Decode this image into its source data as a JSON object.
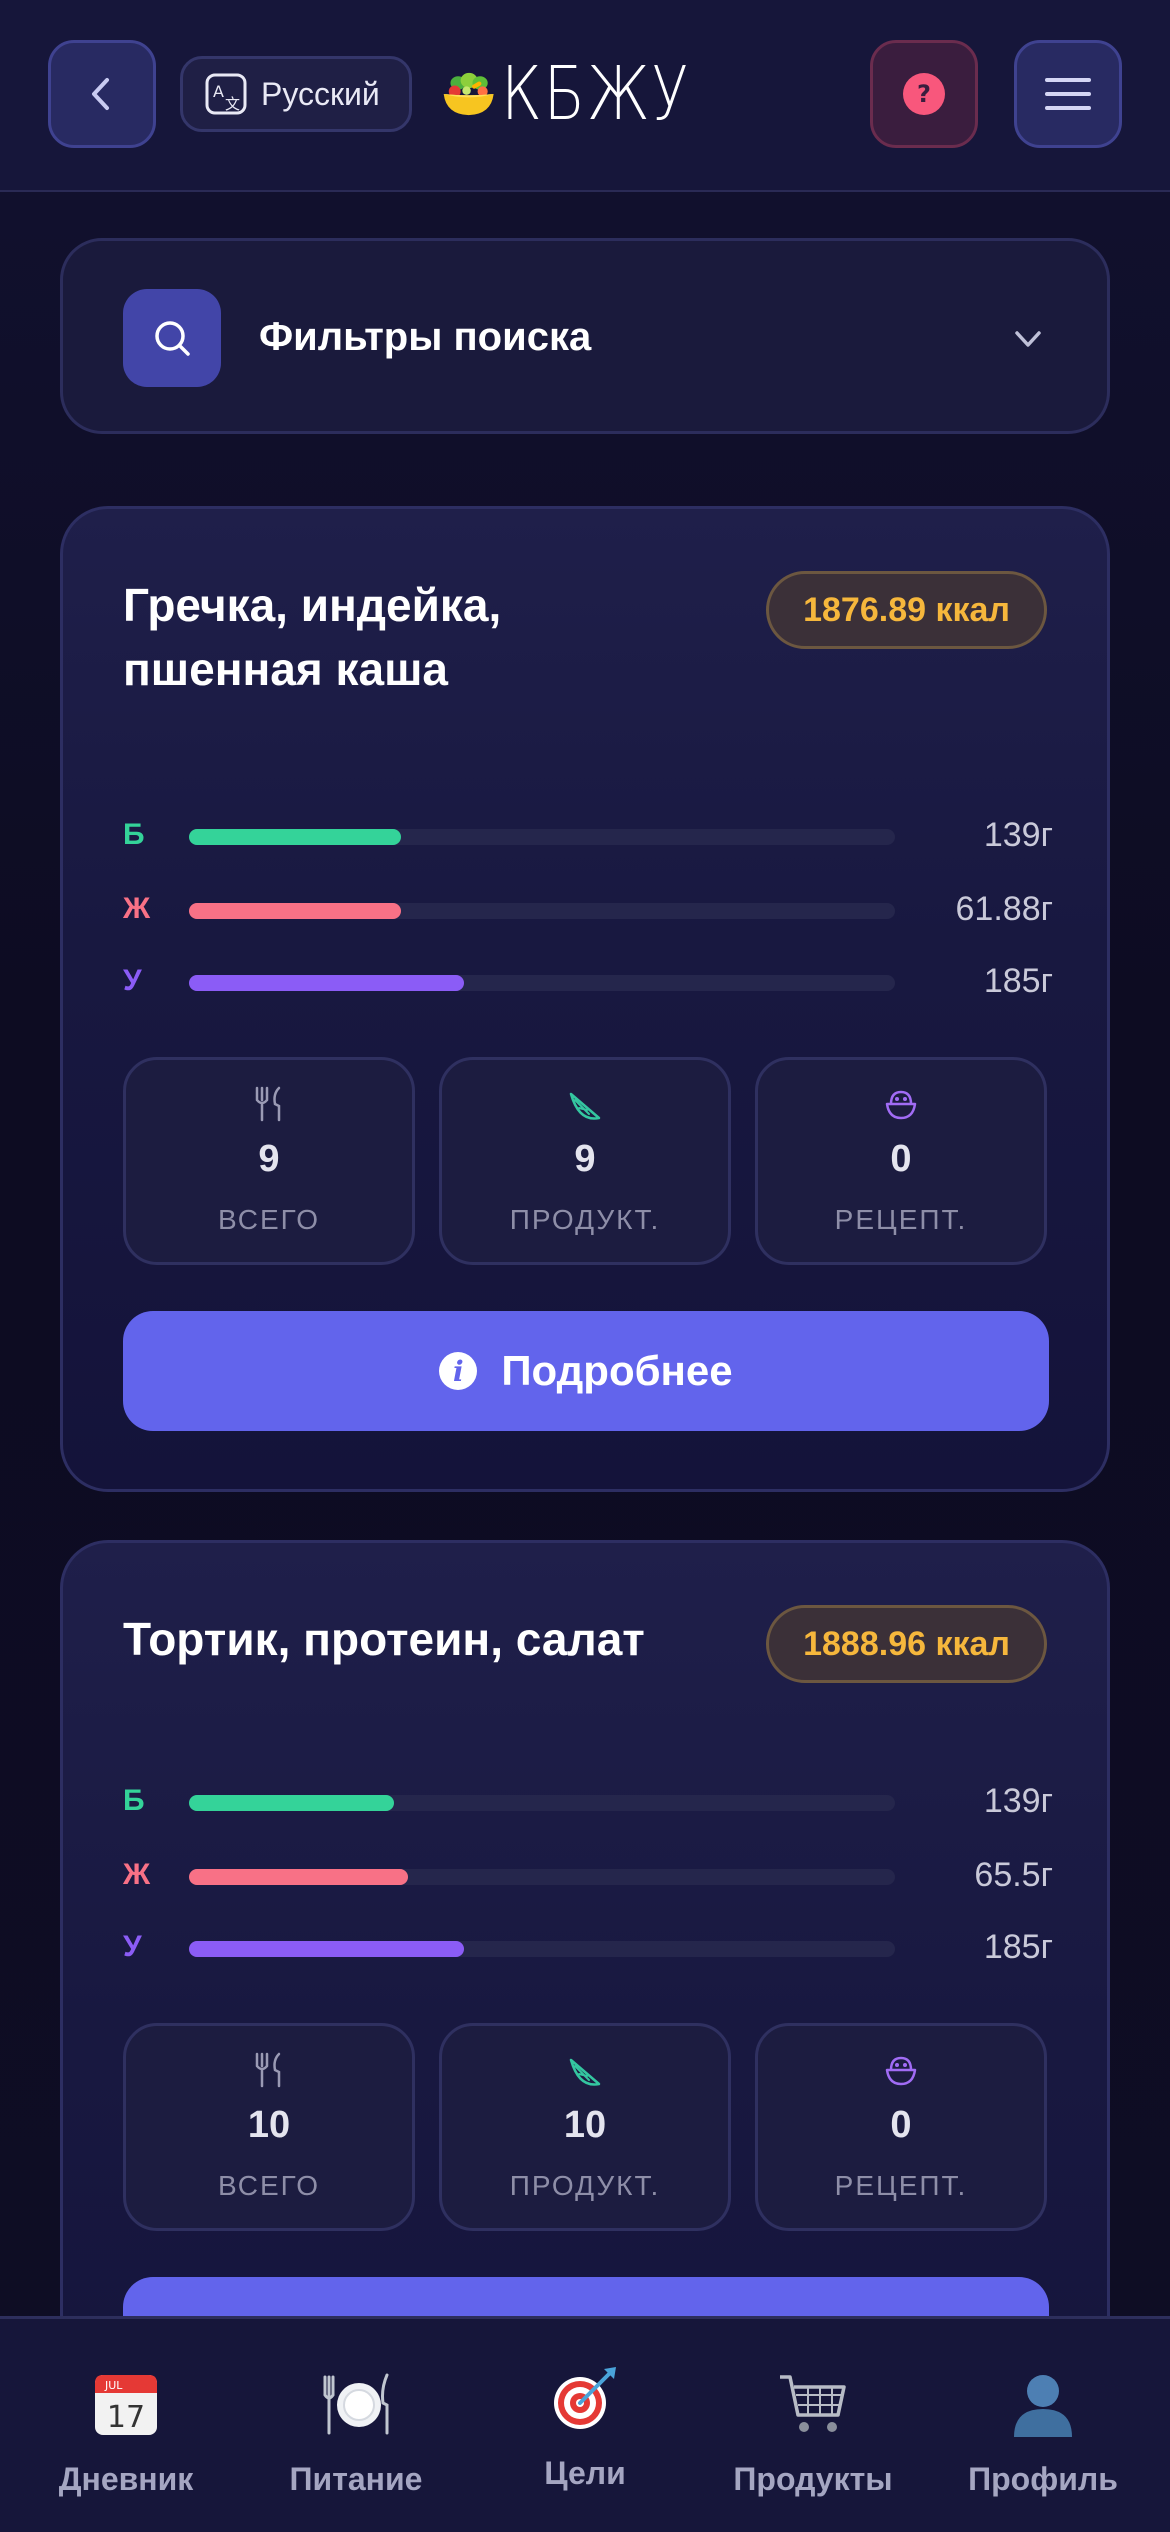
{
  "header": {
    "language": "Русский",
    "logo_text": "КБЖУ"
  },
  "filters": {
    "title": "Фильтры поиска"
  },
  "colors": {
    "protein": "#34d399",
    "fat": "#f87186",
    "carbs": "#8b5cf6",
    "accent": "#6264ec",
    "kcal": "#f6b73c"
  },
  "meals": [
    {
      "name": "Гречка, индейка, пшенная каша",
      "kcal": "1876.89 ккал",
      "macros": [
        {
          "letter": "Б",
          "amount": "139г",
          "level": 0.3
        },
        {
          "letter": "Ж",
          "amount": "61.88г",
          "level": 0.3
        },
        {
          "letter": "У",
          "amount": "185г",
          "level": 0.39
        }
      ],
      "stats": [
        {
          "icon": "cutlery-icon",
          "value": "9",
          "label": "ВСЕГО"
        },
        {
          "icon": "lemon-slice-icon",
          "value": "9",
          "label": "ПРОДУКТ."
        },
        {
          "icon": "bowl-icon",
          "value": "0",
          "label": "РЕЦЕПТ."
        }
      ],
      "button_label": "Подробнее"
    },
    {
      "name": "Тортик, протеин, салат",
      "kcal": "1888.96 ккал",
      "macros": [
        {
          "letter": "Б",
          "amount": "139г",
          "level": 0.29
        },
        {
          "letter": "Ж",
          "amount": "65.5г",
          "level": 0.31
        },
        {
          "letter": "У",
          "amount": "185г",
          "level": 0.39
        }
      ],
      "stats": [
        {
          "icon": "cutlery-icon",
          "value": "10",
          "label": "ВСЕГО"
        },
        {
          "icon": "lemon-slice-icon",
          "value": "10",
          "label": "ПРОДУКТ."
        },
        {
          "icon": "bowl-icon",
          "value": "0",
          "label": "РЕЦЕПТ."
        }
      ]
    }
  ],
  "nav": [
    {
      "label": "Дневник",
      "icon": "calendar-icon"
    },
    {
      "label": "Питание",
      "icon": "plate-icon"
    },
    {
      "label": "Цели",
      "icon": "target-icon"
    },
    {
      "label": "Продукты",
      "icon": "cart-icon"
    },
    {
      "label": "Профиль",
      "icon": "profile-icon"
    }
  ]
}
